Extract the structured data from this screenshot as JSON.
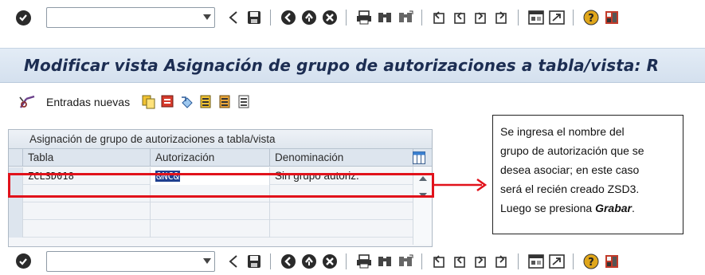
{
  "toolbar": {
    "command_value": "",
    "icons": [
      "ok-icon",
      "back-icon",
      "save-icon",
      "back-green-icon",
      "exit-icon",
      "cancel-icon",
      "print-icon",
      "find-icon",
      "find-next-icon",
      "first-page-icon",
      "previous-page-icon",
      "next-page-icon",
      "last-page-icon",
      "create-session-icon",
      "shortcut-icon",
      "help-icon",
      "layout-icon"
    ]
  },
  "title": "Modificar vista Asignación de grupo de autorizaciones a tabla/vista: R",
  "app_toolbar": {
    "new_entries_label": "Entradas nuevas"
  },
  "table": {
    "title": "Asignación de grupo de autorizaciones a tabla/vista",
    "columns": [
      "Tabla",
      "Autorización",
      "Denominación"
    ],
    "rows": [
      {
        "tabla": "ZCLSD018",
        "autorizacion": "&NC&",
        "denominacion": "Sin grupo autoriz."
      }
    ]
  },
  "callout": {
    "line1": "Se ingresa el nombre del",
    "line2": "grupo de autorización que se",
    "line3": "desea asociar;  en este caso",
    "line4": "será el recién creado ZSD3.",
    "line5_prefix": "Luego se presiona ",
    "line5_bold": "Grabar",
    "line5_suffix": "."
  },
  "colors": {
    "highlight": "#e1121b",
    "title_text": "#1c2d52",
    "titlebar_bg": "#d4e0ee"
  }
}
